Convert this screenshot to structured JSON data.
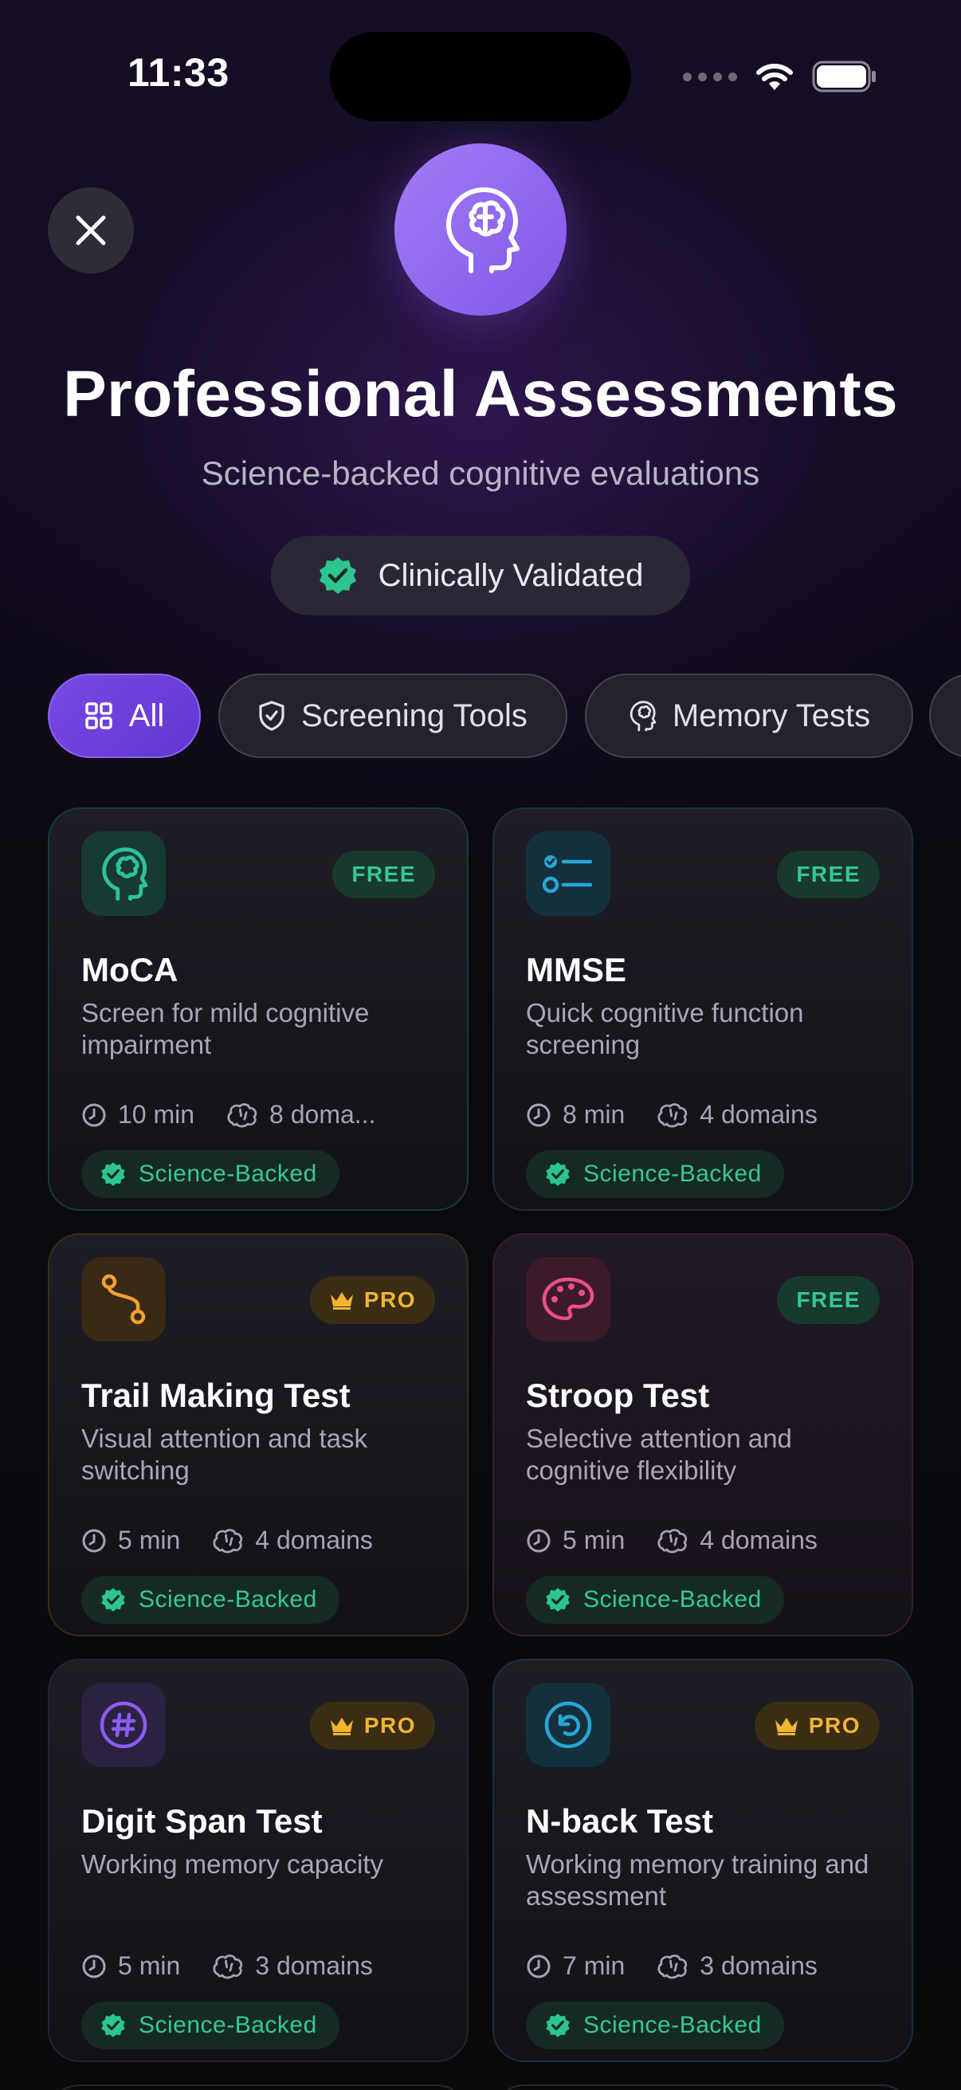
{
  "status_bar": {
    "time": "11:33"
  },
  "header": {
    "title": "Professional Assessments",
    "subtitle": "Science-backed cognitive evaluations",
    "validated_label": "Clinically Validated"
  },
  "filters": [
    {
      "label": "All",
      "icon": "grid-icon",
      "active": true
    },
    {
      "label": "Screening Tools",
      "icon": "shield-check-icon",
      "active": false
    },
    {
      "label": "Memory Tests",
      "icon": "brain-head-icon",
      "active": false
    }
  ],
  "cards": [
    {
      "title": "MoCA",
      "description": "Screen for mild cognitive impairment",
      "duration": "10 min",
      "domains": "8 doma...",
      "badge": "FREE",
      "science_label": "Science-Backed",
      "icon": "brain-icon",
      "accent": "#2ec39a"
    },
    {
      "title": "MMSE",
      "description": "Quick cognitive function screening",
      "duration": "8 min",
      "domains": "4 domains",
      "badge": "FREE",
      "science_label": "Science-Backed",
      "icon": "checklist-icon",
      "accent": "#27a7d6"
    },
    {
      "title": "Trail Making Test",
      "description": "Visual attention and task switching",
      "duration": "5 min",
      "domains": "4 domains",
      "badge": "PRO",
      "science_label": "Science-Backed",
      "icon": "route-icon",
      "accent": "#f0a132"
    },
    {
      "title": "Stroop Test",
      "description": "Selective attention and cognitive flexibility",
      "duration": "5 min",
      "domains": "4 domains",
      "badge": "FREE",
      "science_label": "Science-Backed",
      "icon": "palette-icon",
      "accent": "#e8508a"
    },
    {
      "title": "Digit Span Test",
      "description": "Working memory capacity",
      "duration": "5 min",
      "domains": "3 domains",
      "badge": "PRO",
      "science_label": "Science-Backed",
      "icon": "hash-icon",
      "accent": "#8b5cf0"
    },
    {
      "title": "N-back Test",
      "description": "Working memory training and assessment",
      "duration": "7 min",
      "domains": "3 domains",
      "badge": "PRO",
      "science_label": "Science-Backed",
      "icon": "rotate-icon",
      "accent": "#27a7d6"
    }
  ],
  "colors": {
    "accent_purple": "#7a48e6",
    "free_green": "#34c88f",
    "pro_gold": "#f3b431"
  }
}
